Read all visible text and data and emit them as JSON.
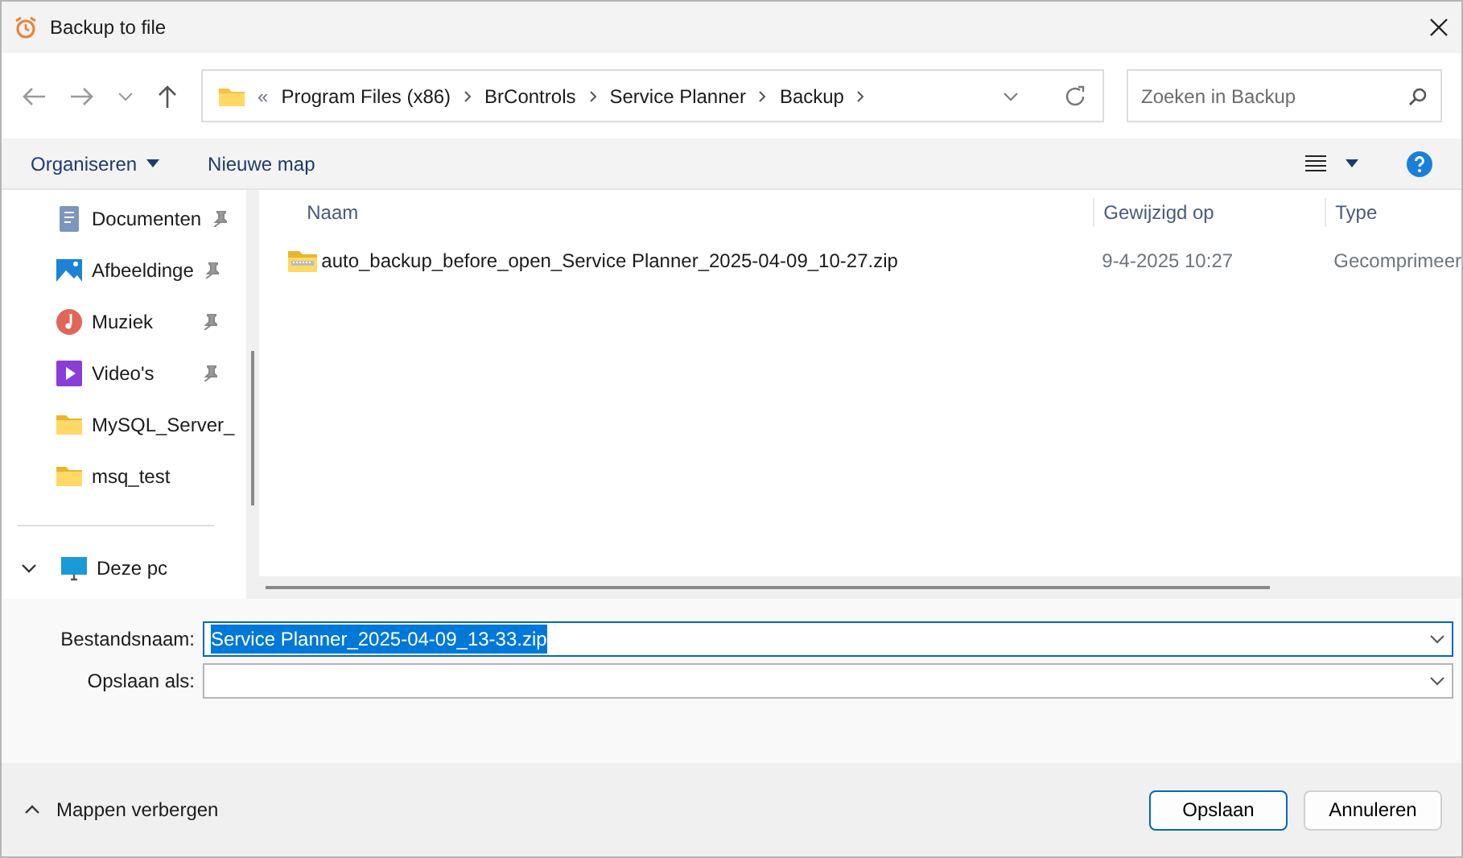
{
  "window": {
    "title": "Backup to file"
  },
  "address": {
    "overflow": "«",
    "crumbs": [
      "Program Files (x86)",
      "BrControls",
      "Service Planner",
      "Backup"
    ]
  },
  "search": {
    "placeholder": "Zoeken in Backup"
  },
  "toolbar": {
    "organize": "Organiseren",
    "new_folder": "Nieuwe map"
  },
  "sidebar": {
    "items": [
      {
        "label": "Documenten",
        "kind": "documents",
        "pinned": true
      },
      {
        "label": "Afbeeldinge",
        "kind": "pictures",
        "pinned": true
      },
      {
        "label": "Muziek",
        "kind": "music",
        "pinned": true
      },
      {
        "label": "Video's",
        "kind": "videos",
        "pinned": true
      },
      {
        "label": "MySQL_Server_",
        "kind": "folder",
        "pinned": false
      },
      {
        "label": "msq_test",
        "kind": "folder",
        "pinned": false
      },
      {
        "label": "Deze pc",
        "kind": "pc",
        "pinned": false,
        "expanded": true,
        "divider_before": true
      }
    ]
  },
  "table": {
    "columns": [
      "Naam",
      "Gewijzigd op",
      "Type"
    ],
    "rows": [
      {
        "name": "auto_backup_before_open_Service Planner_2025-04-09_10-27.zip",
        "modified": "9-4-2025 10:27",
        "type": "Gecomprimeer",
        "kind": "zip"
      }
    ]
  },
  "form": {
    "filename_label": "Bestandsnaam:",
    "filename": "Service Planner_2025-04-09_13-33.zip",
    "filename_selected": true,
    "savetype_label": "Opslaan als:"
  },
  "footer": {
    "toggle": "Mappen verbergen",
    "buttons": [
      {
        "label": "Opslaan",
        "primary": true
      },
      {
        "label": "Annuleren",
        "primary": false
      }
    ]
  }
}
